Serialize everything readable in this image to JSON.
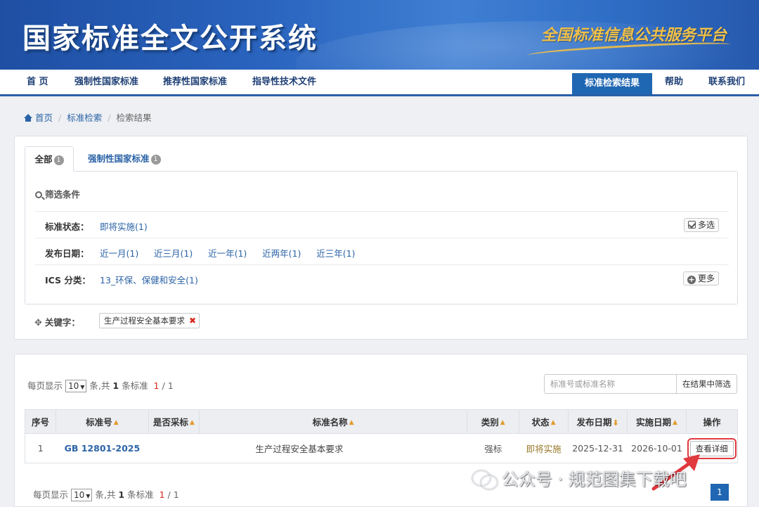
{
  "header": {
    "title": "国家标准全文公开系统",
    "slogan": "全国标准信息公共服务平台"
  },
  "nav": {
    "items": [
      "首 页",
      "强制性国家标准",
      "推荐性国家标准",
      "指导性技术文件"
    ],
    "active": "标准检索结果",
    "right": [
      "帮助",
      "联系我们"
    ]
  },
  "breadcrumb": [
    "首页",
    "标准检索",
    "检索结果"
  ],
  "tabs": [
    {
      "label": "全部",
      "count": "1"
    },
    {
      "label": "强制性国家标准",
      "count": "1"
    }
  ],
  "filter": {
    "title": "筛选条件",
    "rows": [
      {
        "label": "标准状态：",
        "options": [
          "即将实施(1)"
        ],
        "button": "多选",
        "button_icon": "check-icon"
      },
      {
        "label": "发布日期：",
        "options": [
          "近一月(1)",
          "近三月(1)",
          "近一年(1)",
          "近两年(1)",
          "近三年(1)"
        ]
      },
      {
        "label": "ICS 分类：",
        "options": [
          "13_环保、保健和安全(1)"
        ],
        "button": "更多",
        "button_icon": "plus-icon"
      }
    ],
    "keyword_label": "关键字：",
    "keyword": "生产过程安全基本要求"
  },
  "results": {
    "per_page_prefix": "每页显示",
    "per_page": "10",
    "summary_mid": "条,共",
    "total": "1",
    "summary_suffix": "条标准",
    "page_current": "1",
    "page_sep": "/",
    "page_total": "1",
    "search_placeholder": "标准号或标准名称",
    "search_button": "在结果中筛选",
    "columns": [
      "序号",
      "标准号",
      "是否采标",
      "标准名称",
      "类别",
      "状态",
      "发布日期",
      "实施日期",
      "操作"
    ],
    "rows": [
      {
        "index": "1",
        "code": "GB 12801-2025",
        "adopted": "",
        "name": "生产过程安全基本要求",
        "category": "强标",
        "status": "即将实施",
        "publish_date": "2025-12-31",
        "impl_date": "2026-10-01",
        "action": "查看详细"
      }
    ],
    "page_button": "1"
  },
  "watermark": "公众号 · 规范图集下载吧",
  "colors": {
    "brand_blue": "#1f66b3",
    "link": "#2b63a6",
    "highlight_red": "#e0393e",
    "sort_orange": "#e39a2b"
  }
}
